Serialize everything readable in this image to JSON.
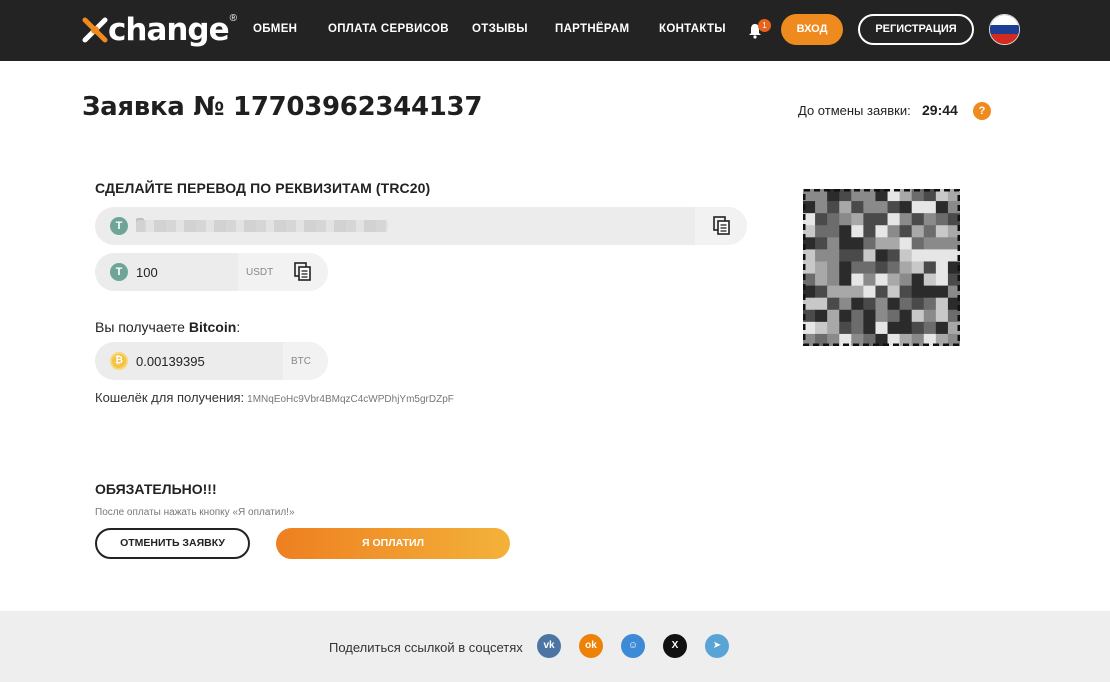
{
  "header": {
    "logo_text": "change",
    "logo_reg": "®",
    "nav": [
      {
        "label": "ОБМЕН"
      },
      {
        "label": "ОПЛАТА СЕРВИСОВ"
      },
      {
        "label": "ОТЗЫВЫ"
      },
      {
        "label": "ПАРТНЁРАМ"
      },
      {
        "label": "КОНТАКТЫ"
      }
    ],
    "notification_count": "1",
    "login_label": "ВХОД",
    "register_label": "РЕГИСТРАЦИЯ",
    "language_flag": "russia-flag-icon"
  },
  "order": {
    "title": "Заявка № 17703962344137",
    "timer_label": "До отмены заявки:",
    "timer_value": "29:44",
    "help_label": "?"
  },
  "transfer": {
    "section_title": "СДЕЛАЙТЕ ПЕРЕВОД ПО РЕКВИЗИТАМ (TRC20)",
    "address_visible_start": "T",
    "address_visible_end": "3",
    "amount": "100",
    "amount_unit": "USDT",
    "coin_icon": "tether-icon"
  },
  "receive": {
    "label_prefix": "Вы получаете ",
    "currency_name": "Bitcoin",
    "label_suffix": ":",
    "amount": "0.00139395",
    "unit": "BTC",
    "coin_icon": "bitcoin-icon",
    "wallet_label": "Кошелёк для получения:",
    "wallet_address": "1MNqEoHc9Vbr4BMqzC4cWPDhjYm5grDZpF"
  },
  "mandatory": {
    "title": "ОБЯЗАТЕЛЬНО!!!",
    "note": "После оплаты нажать кнопку «Я оплатил!»",
    "cancel_label": "ОТМЕНИТЬ ЗАЯВКУ",
    "paid_label": "Я ОПЛАТИЛ"
  },
  "footer": {
    "share_label": "Поделиться ссылкой в соцсетях",
    "socials": [
      {
        "name": "vk-icon",
        "glyph": "vk",
        "color": "#4c75a3"
      },
      {
        "name": "odnoklassniki-icon",
        "glyph": "ok",
        "color": "#ee8208"
      },
      {
        "name": "moimir-icon",
        "glyph": "☺",
        "color": "#3d8ad6"
      },
      {
        "name": "x-icon",
        "glyph": "X",
        "color": "#111111"
      },
      {
        "name": "telegram-icon",
        "glyph": "➤",
        "color": "#5aa3d6"
      }
    ]
  },
  "colors": {
    "accent": "#ef8a1f",
    "header_bg": "#232323",
    "tether": "#6fa597",
    "bitcoin": "#f5c242"
  }
}
